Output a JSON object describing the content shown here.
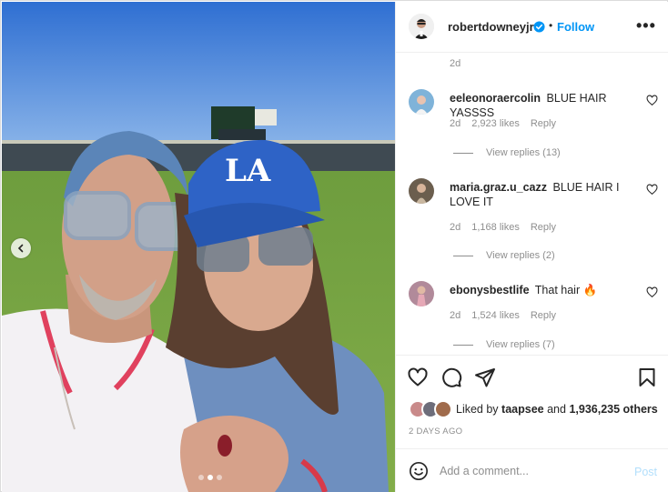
{
  "post": {
    "author": "robertdowneyjr",
    "follow_label": "Follow",
    "separator": "•",
    "more_label": "•••",
    "time_ago": "2d"
  },
  "comments": [
    {
      "username": "eeleonoraercolin",
      "text": "BLUE HAIR YASSSS",
      "age": "2d",
      "likes": "2,923 likes",
      "reply_label": "Reply",
      "view_replies": "View replies (13)",
      "avatar_color": "#7fb3d9"
    },
    {
      "username": "maria.graz.u_cazz",
      "text": "BLUE HAIR I LOVE IT",
      "age": "2d",
      "likes": "1,168 likes",
      "reply_label": "Reply",
      "view_replies": "View replies (2)",
      "avatar_color": "#6b5e4e"
    },
    {
      "username": "ebonysbestlife",
      "text": "That hair 🔥",
      "age": "2d",
      "likes": "1,524 likes",
      "reply_label": "Reply",
      "view_replies": "View replies (7)",
      "avatar_color": "#b18a9a"
    }
  ],
  "likes": {
    "prefix": "Liked by",
    "user": "taapsee",
    "joiner": "and",
    "count": "1,936,235 others"
  },
  "date_label": "2 DAYS AGO",
  "add_comment": {
    "placeholder": "Add a comment...",
    "post_label": "Post"
  },
  "colors": {
    "link_blue": "#0095f6",
    "post_disabled": "#b2dffc",
    "muted": "#8e8e8e",
    "text": "#262626"
  },
  "carousel": {
    "current_slide": 1,
    "slide_count": 3
  },
  "icons": [
    "chevron-left-icon",
    "verified-icon",
    "heart-icon",
    "comment-icon",
    "share-icon",
    "bookmark-icon",
    "emoji-icon"
  ]
}
